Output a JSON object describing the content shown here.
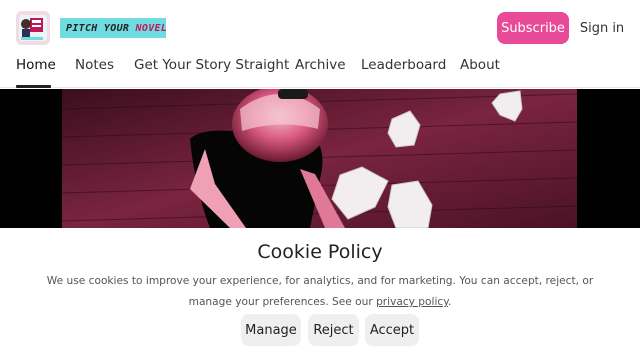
{
  "colors": {
    "brand_pink": "#e84a97",
    "logo_teal": "#6fdde0",
    "hero_background": "#000000"
  },
  "header": {
    "logo_icon": "pitch-your-novel-book-icon",
    "logo_word_part1": "PITCH YOUR",
    "logo_word_part2": "NOVEL",
    "subscribe_label": "Subscribe",
    "signin_label": "Sign in"
  },
  "nav": {
    "items": [
      {
        "label": "Home",
        "active": true
      },
      {
        "label": "Notes"
      },
      {
        "label": "Get Your Story Straight"
      },
      {
        "label": "Archive"
      },
      {
        "label": "Leaderboard"
      },
      {
        "label": "About"
      }
    ]
  },
  "hero": {
    "image_subject": "writer-crumpled-paper-photo"
  },
  "cookie": {
    "title": "Cookie Policy",
    "text_before_link": "We use cookies to improve your experience, for analytics, and for marketing. You can accept, reject, or manage your preferences. See our ",
    "link_label": "privacy policy",
    "text_after_link": ".",
    "buttons": {
      "manage": "Manage",
      "reject": "Reject",
      "accept": "Accept"
    }
  }
}
